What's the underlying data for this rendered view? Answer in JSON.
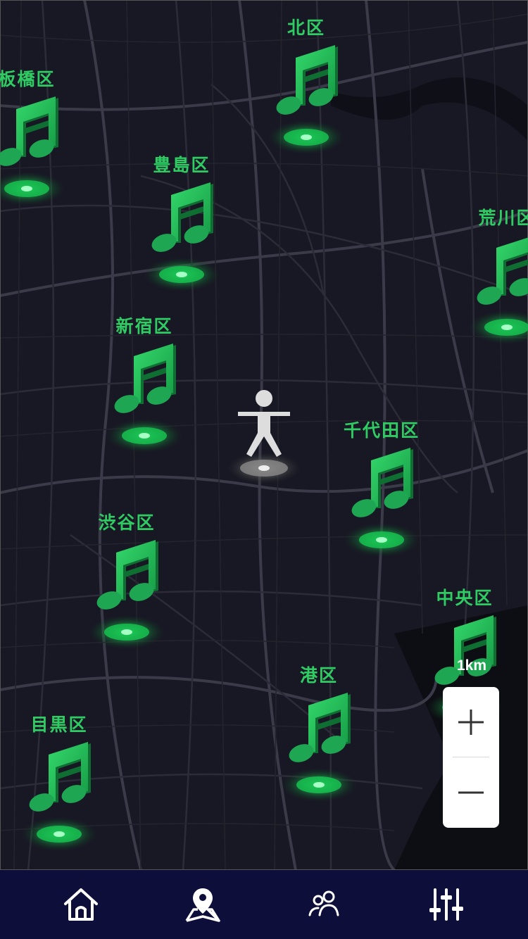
{
  "map": {
    "theme_color": "#2ecc63",
    "districts": [
      {
        "id": "kita",
        "name": "北区"
      },
      {
        "id": "itabashi",
        "name": "板橋区"
      },
      {
        "id": "toshima",
        "name": "豊島区"
      },
      {
        "id": "arakawa",
        "name": "荒川区"
      },
      {
        "id": "shinjuku",
        "name": "新宿区"
      },
      {
        "id": "chiyoda",
        "name": "千代田区"
      },
      {
        "id": "shibuya",
        "name": "渋谷区"
      },
      {
        "id": "chuo",
        "name": "中央区"
      },
      {
        "id": "minato",
        "name": "港区"
      },
      {
        "id": "meguro",
        "name": "目黒区"
      }
    ],
    "marker_icon": "music-note-icon",
    "user_icon": "person-icon"
  },
  "scale": {
    "label": "1km"
  },
  "zoom": {
    "in_icon": "plus-icon",
    "out_icon": "minus-icon"
  },
  "tabbar": {
    "background": "#0e0e3a",
    "tabs": [
      {
        "icon": "home-icon"
      },
      {
        "icon": "map-pin-icon"
      },
      {
        "icon": "people-icon"
      },
      {
        "icon": "sliders-icon"
      }
    ]
  }
}
